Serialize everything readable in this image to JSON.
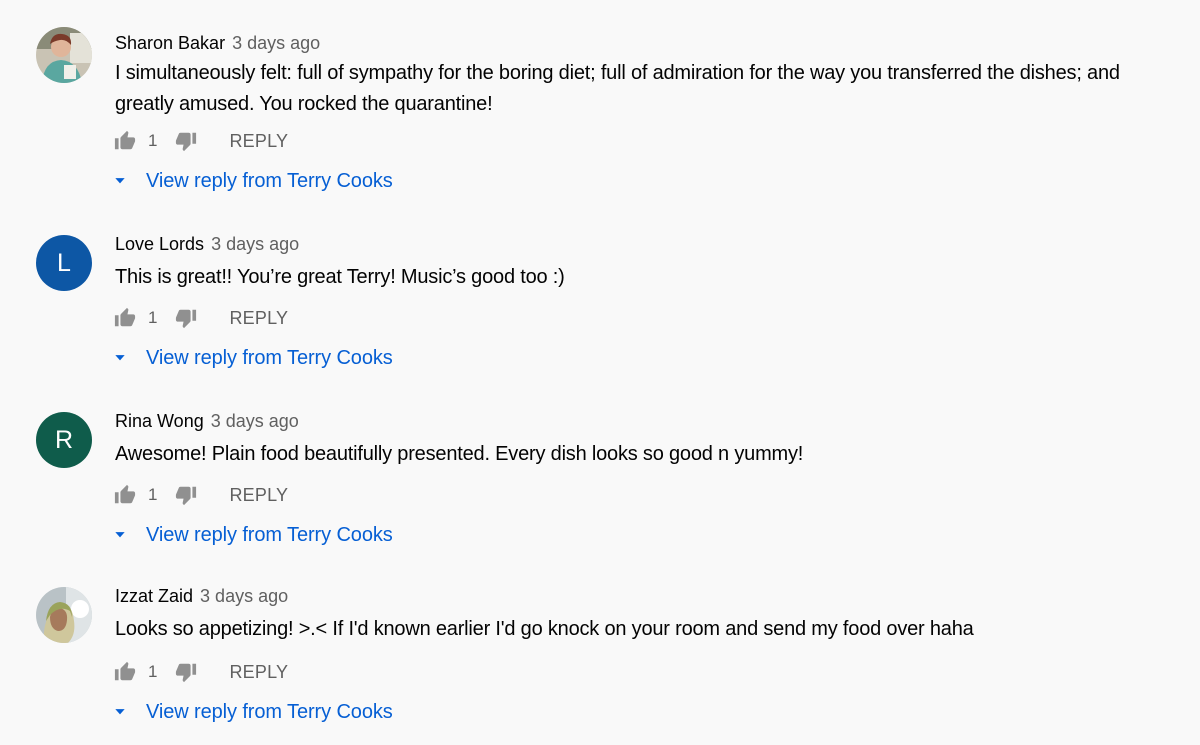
{
  "comments": [
    {
      "author": "Sharon Bakar",
      "time": "3 days ago",
      "text": "I simultaneously felt: full of sympathy for the boring diet; full of admiration for the way you transferred the dishes; and greatly amused.  You rocked the quarantine!",
      "likes": "1",
      "reply_label": "REPLY",
      "view_replies": "View reply from Terry Cooks",
      "avatar": {
        "kind": "photo",
        "icon": "user-photo"
      }
    },
    {
      "author": "Love Lords",
      "time": "3 days ago",
      "text": "This is great!! You’re great Terry! Music’s good too :)",
      "likes": "1",
      "reply_label": "REPLY",
      "view_replies": "View reply from Terry Cooks",
      "avatar": {
        "kind": "letter",
        "letter": "L",
        "color": "#0d57a5"
      }
    },
    {
      "author": "Rina Wong",
      "time": "3 days ago",
      "text": "Awesome! Plain food beautifully presented.  Every dish looks so good n yummy!",
      "likes": "1",
      "reply_label": "REPLY",
      "view_replies": "View reply from Terry Cooks",
      "avatar": {
        "kind": "letter",
        "letter": "R",
        "color": "#0f5c4b"
      }
    },
    {
      "author": "Izzat Zaid",
      "time": "3 days ago",
      "text": "Looks so appetizing! >.< If I'd known earlier I'd go knock on your room and send my food over haha",
      "likes": "1",
      "reply_label": "REPLY",
      "view_replies": "View reply from Terry Cooks",
      "avatar": {
        "kind": "photo",
        "icon": "user-photo"
      }
    }
  ],
  "icons": {
    "like": "thumb-up-icon",
    "dislike": "thumb-down-icon",
    "expand": "caret-down-icon"
  },
  "colors": {
    "background": "#f9f9f9",
    "link_blue": "#065fd4",
    "secondary_text": "#606060",
    "icon_gray": "#909090"
  }
}
